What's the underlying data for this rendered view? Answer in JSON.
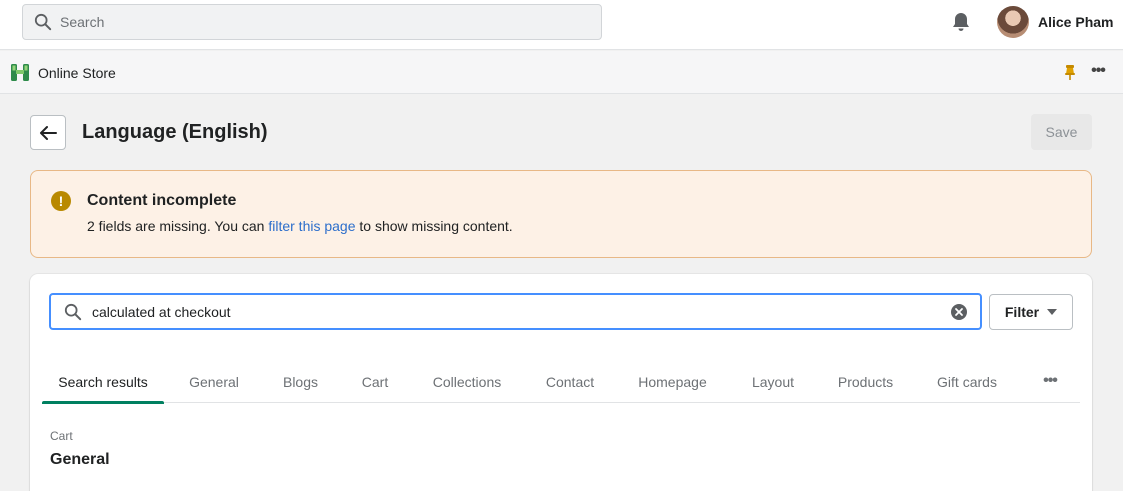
{
  "topbar": {
    "search_placeholder": "Search",
    "user_name": "Alice Pham"
  },
  "appbar": {
    "store_label": "Online Store"
  },
  "page": {
    "title": "Language (English)",
    "save_label": "Save"
  },
  "banner": {
    "title": "Content incomplete",
    "message_before": "2 fields are missing. You can ",
    "message_link": "filter this page",
    "message_after": " to show missing content."
  },
  "search": {
    "value": "calculated at checkout",
    "filter_label": "Filter"
  },
  "tabs": [
    {
      "label": "Search results",
      "active": true
    },
    {
      "label": "General"
    },
    {
      "label": "Blogs"
    },
    {
      "label": "Cart"
    },
    {
      "label": "Collections"
    },
    {
      "label": "Contact"
    },
    {
      "label": "Homepage"
    },
    {
      "label": "Layout"
    },
    {
      "label": "Products"
    },
    {
      "label": "Gift cards"
    }
  ],
  "result": {
    "caption": "Cart",
    "title": "General"
  },
  "colors": {
    "accent_green": "#008060",
    "focus_blue": "#458fff",
    "link_blue": "#2c6ecb",
    "warning_bg": "#fdf1e6",
    "warning_icon": "#b98900"
  }
}
